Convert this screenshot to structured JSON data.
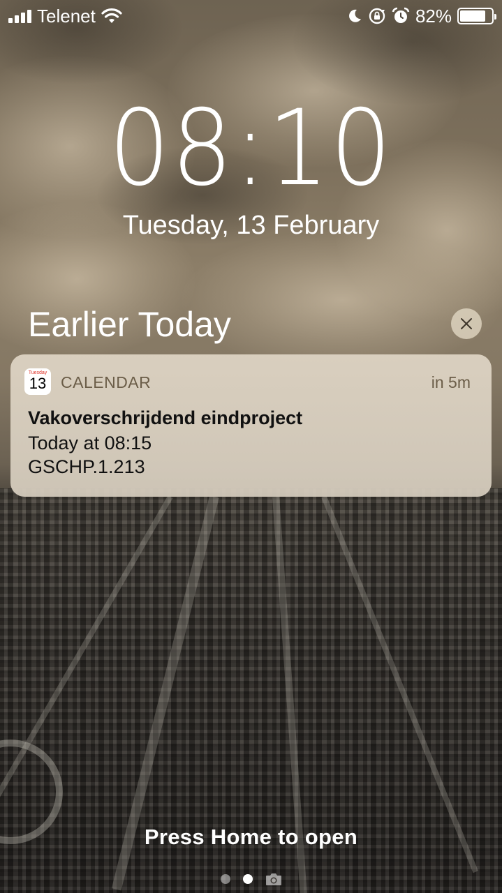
{
  "status_bar": {
    "carrier": "Telenet",
    "battery_percent": "82%",
    "battery_level": 0.82,
    "icons": [
      "signal-icon",
      "wifi-icon",
      "moon-icon",
      "rotation-lock-icon",
      "alarm-icon",
      "battery-icon"
    ]
  },
  "lock_screen": {
    "time": "08:10",
    "date": "Tuesday, 13 February"
  },
  "notifications": {
    "section_title": "Earlier Today",
    "clear_icon": "close-icon",
    "items": [
      {
        "app_icon": {
          "name": "calendar-icon",
          "day_label": "Tuesday",
          "day_number": "13"
        },
        "app_name": "CALENDAR",
        "time": "in 5m",
        "title": "Vakoverschrijdend eindproject",
        "lines": [
          "Today at 08:15",
          "GSCHP.1.213"
        ]
      }
    ]
  },
  "footer": {
    "hint": "Press Home to open",
    "pages": 3,
    "active_page": 2,
    "camera_icon": "camera-icon"
  },
  "colors": {
    "notification_background": "#ded4c4",
    "notification_secondary_text": "#6b5d48",
    "calendar_red": "#e0352b"
  }
}
